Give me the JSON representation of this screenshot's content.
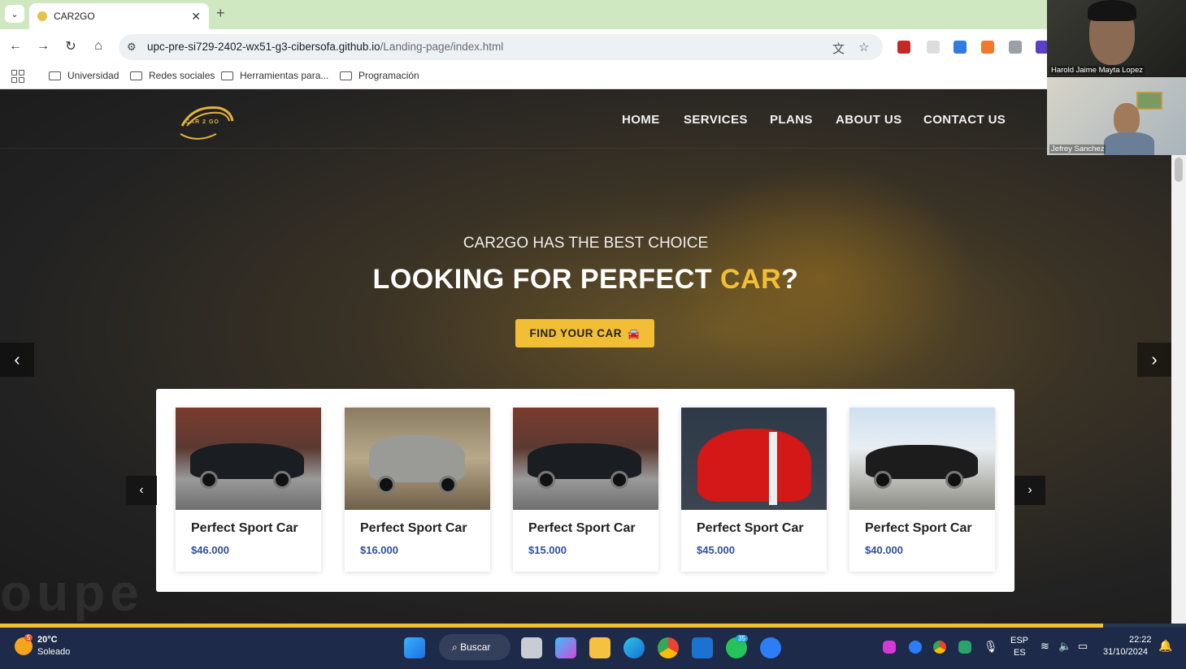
{
  "browser": {
    "tab_title": "CAR2GO",
    "url_host": "upc-pre-si729-2402-wx51-g3-cibersofa.github.io",
    "url_path": "/Landing-page/index.html",
    "bookmarks": [
      "Universidad",
      "Redes sociales",
      "Herramientas para...",
      "Programación"
    ]
  },
  "site": {
    "logo_text": "CAR 2 GO",
    "nav": [
      "HOME",
      "SERVICES",
      "PLANS",
      "ABOUT US",
      "CONTACT US"
    ],
    "hero_subtitle": "CAR2GO HAS THE BEST CHOICE",
    "hero_title_main": "LOOKING FOR PERFECT ",
    "hero_title_accent": "CAR",
    "hero_title_end": "?",
    "cta_label": "FIND YOUR CAR",
    "bg_word": "oupe",
    "cards": [
      {
        "name": "Perfect Sport Car",
        "price": "$46.000"
      },
      {
        "name": "Perfect Sport Car",
        "price": "$16.000"
      },
      {
        "name": "Perfect Sport Car",
        "price": "$15.000"
      },
      {
        "name": "Perfect Sport Car",
        "price": "$45.000"
      },
      {
        "name": "Perfect Sport Car",
        "price": "$40.000"
      }
    ]
  },
  "video": {
    "participant_1": "Harold Jaime Mayta Lopez",
    "participant_2": "Jefrey Sanchez"
  },
  "taskbar": {
    "weather_temp": "20°C",
    "weather_desc": "Soleado",
    "weather_badge": "5",
    "search_label": "Buscar",
    "whatsapp_badge": "35",
    "lang_1": "ESP",
    "lang_2": "ES",
    "time": "22:22",
    "date": "31/10/2024"
  },
  "colors": {
    "accent": "#f2be36",
    "price": "#2f4f9a",
    "taskbar": "#1d2a4a"
  }
}
